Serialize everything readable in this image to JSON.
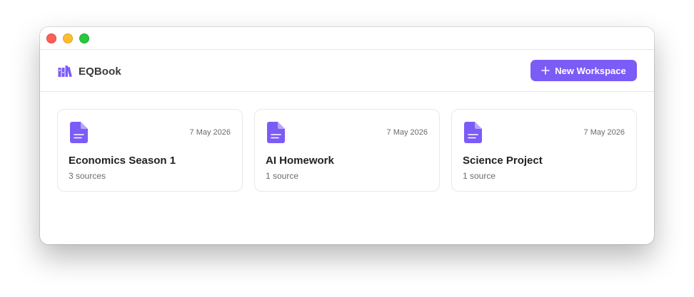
{
  "app": {
    "name": "EQBook",
    "icon": "library-books-icon",
    "accent_color": "#7b5cf6"
  },
  "header": {
    "new_button_label": "New Workspace",
    "new_button_icon": "plus-icon"
  },
  "workspaces": [
    {
      "title": "Economics Season 1",
      "sources": "3 sources",
      "date": "7 May 2026",
      "icon": "document-icon"
    },
    {
      "title": "AI Homework",
      "sources": "1 source",
      "date": "7 May 2026",
      "icon": "document-icon"
    },
    {
      "title": "Science Project",
      "sources": "1 source",
      "date": "7 May 2026",
      "icon": "document-icon"
    }
  ]
}
